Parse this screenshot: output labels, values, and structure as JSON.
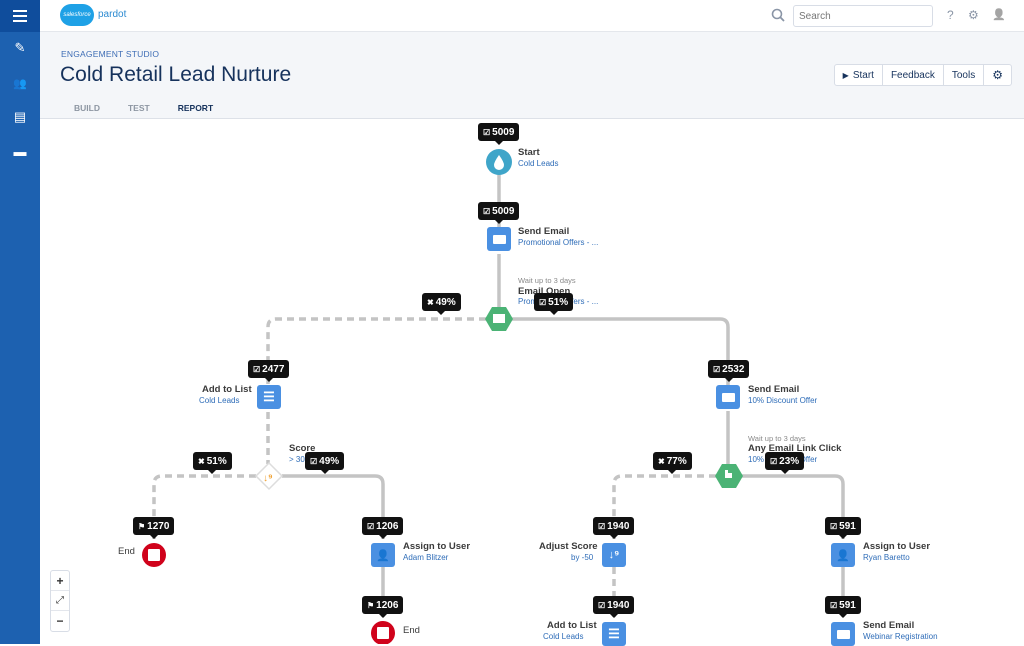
{
  "app": {
    "brand": "salesforce",
    "product": "pardot"
  },
  "topbar": {
    "search_placeholder": "Search",
    "icons": [
      "search-icon",
      "help-icon",
      "settings-icon",
      "user-icon"
    ],
    "help_glyph": "?",
    "settings_glyph": "⚙",
    "user_glyph": "👤"
  },
  "sidebar": {
    "items": [
      {
        "name": "menu-icon"
      },
      {
        "name": "wand-icon",
        "glyph": "✎"
      },
      {
        "name": "people-icon",
        "glyph": "👥"
      },
      {
        "name": "reports-icon",
        "glyph": "▤"
      },
      {
        "name": "briefcase-icon",
        "glyph": "▬"
      }
    ]
  },
  "header": {
    "eyebrow": "ENGAGEMENT STUDIO",
    "title": "Cold Retail Lead Nurture",
    "tabs": [
      {
        "label": "BUILD",
        "active": false
      },
      {
        "label": "TEST",
        "active": false
      },
      {
        "label": "REPORT",
        "active": true
      }
    ],
    "buttons": {
      "start": "Start",
      "start_glyph": "▶",
      "feedback": "Feedback",
      "tools": "Tools",
      "gear_glyph": "⚙"
    }
  },
  "colors": {
    "sidebar": "#1d61b0",
    "action_blue": "#4a90e2",
    "trigger_green": "#4bb375",
    "start_teal": "#3fa5c9",
    "end_red": "#d0021b",
    "rule_orange": "#f0a030",
    "line_gray": "#c4c4c4"
  },
  "flow": {
    "nodes": [
      {
        "id": "start",
        "type": "start",
        "title": "Start",
        "sub": "Cold Leads",
        "badge": "5009",
        "badge_icon": "check"
      },
      {
        "id": "email1",
        "type": "action",
        "title": "Send Email",
        "sub": "Promotional Offers - ...",
        "badge": "5009",
        "badge_icon": "check"
      },
      {
        "id": "trigger1",
        "type": "trigger",
        "wait": "Wait up to 3 days",
        "title": "Email Open",
        "sub": "Promotional Offers - ...",
        "no_badge": "49%",
        "yes_badge": "51%"
      },
      {
        "id": "list1",
        "type": "action",
        "title": "Add to List",
        "sub": "Cold Leads",
        "badge": "2477",
        "badge_icon": "check"
      },
      {
        "id": "rule1",
        "type": "rule",
        "title": "Score",
        "sub": "> 30",
        "no_badge": "51%",
        "yes_badge": "49%"
      },
      {
        "id": "end1",
        "type": "end",
        "title": "End",
        "badge": "1270",
        "badge_icon": "flag"
      },
      {
        "id": "assign1",
        "type": "action",
        "title": "Assign to User",
        "sub": "Adam Blitzer",
        "badge": "1206",
        "badge_icon": "check"
      },
      {
        "id": "end2",
        "type": "end",
        "title": "End",
        "badge": "1206",
        "badge_icon": "flag"
      },
      {
        "id": "email2",
        "type": "action",
        "title": "Send Email",
        "sub": "10% Discount Offer",
        "badge": "2532",
        "badge_icon": "check"
      },
      {
        "id": "trigger2",
        "type": "trigger",
        "wait": "Wait up to 3 days",
        "title": "Any Email Link Click",
        "sub": "10% Discount Offer",
        "no_badge": "77%",
        "yes_badge": "23%"
      },
      {
        "id": "score2",
        "type": "action",
        "title": "Adjust Score",
        "sub": "by -50",
        "badge": "1940",
        "badge_icon": "check"
      },
      {
        "id": "list2",
        "type": "action",
        "title": "Add to List",
        "sub": "Cold Leads",
        "badge": "1940",
        "badge_icon": "check"
      },
      {
        "id": "assign2",
        "type": "action",
        "title": "Assign to User",
        "sub": "Ryan Baretto",
        "badge": "591",
        "badge_icon": "check"
      },
      {
        "id": "email3",
        "type": "action",
        "title": "Send Email",
        "sub": "Webinar Registration",
        "badge": "591",
        "badge_icon": "check"
      }
    ]
  },
  "zoom_controls": {
    "zoom_in": "+",
    "fit": "⤢",
    "zoom_out": "−"
  }
}
